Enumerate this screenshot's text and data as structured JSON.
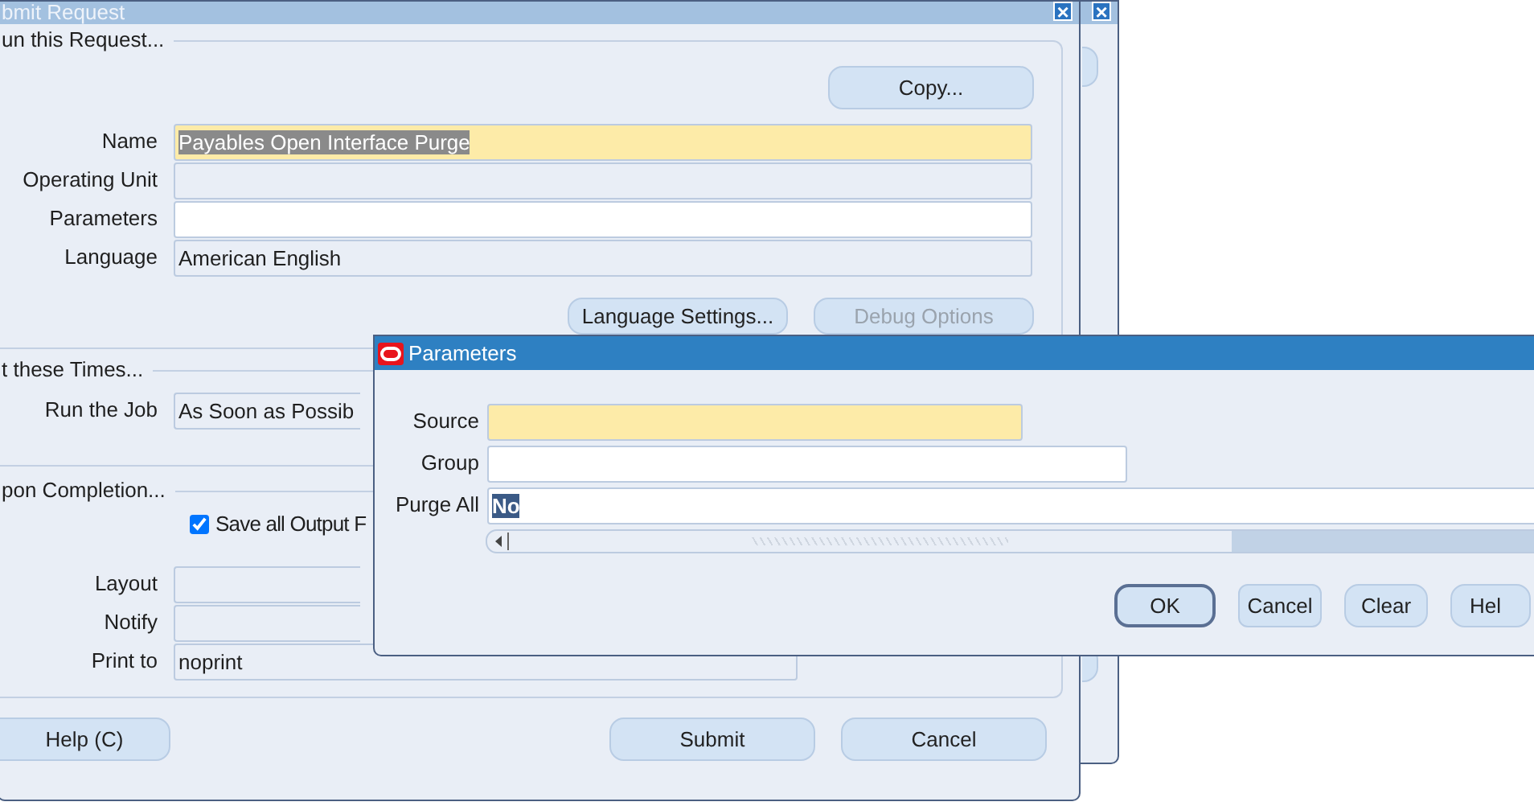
{
  "back_window": {
    "close": "×"
  },
  "submit_request": {
    "title": "bmit Request",
    "close": "×",
    "request_section": {
      "title": "un this Request...",
      "copy_button": "Copy...",
      "fields": [
        {
          "label": "Name",
          "value": "Payables Open Interface Purge",
          "kind": "required",
          "selected": true
        },
        {
          "label": "Operating Unit",
          "kind": "readonly"
        },
        {
          "label": "Parameters",
          "kind": "input"
        },
        {
          "label": "Language",
          "value": "American English",
          "kind": "readonly",
          "selected": false
        }
      ],
      "buttons": [
        {
          "label": "Language Settings...",
          "disabled": false
        },
        {
          "label": "Debug Options",
          "disabled": true
        }
      ]
    },
    "times_section": {
      "title": "t these Times...",
      "fields": [
        {
          "label": "Run the Job",
          "value": "As Soon as Possib",
          "kind": "readonly",
          "selected": false
        }
      ]
    },
    "completion_section": {
      "title": "pon Completion...",
      "save_output": {
        "label": "Save all Output F",
        "checked": true
      },
      "fields": [
        {
          "label": "Layout",
          "kind": "readonly"
        },
        {
          "label": "Notify",
          "kind": "readonly"
        },
        {
          "label": "Print to",
          "value": "noprint",
          "kind": "readonly",
          "selected": false
        }
      ]
    },
    "buttons": [
      {
        "label": "Help (C)"
      },
      {
        "label": "Submit"
      },
      {
        "label": "Cancel"
      }
    ]
  },
  "parameters_dialog": {
    "title": "Parameters",
    "fields": [
      {
        "label": "Source",
        "kind": "required"
      },
      {
        "label": "Group",
        "kind": "input"
      },
      {
        "label": "Purge All",
        "value": "No",
        "kind": "input",
        "selected": true
      }
    ],
    "buttons": [
      {
        "label": "OK",
        "default": true
      },
      {
        "label": "Cancel",
        "default": false
      },
      {
        "label": "Clear",
        "default": false
      },
      {
        "label": "Hel",
        "default": false
      }
    ]
  }
}
